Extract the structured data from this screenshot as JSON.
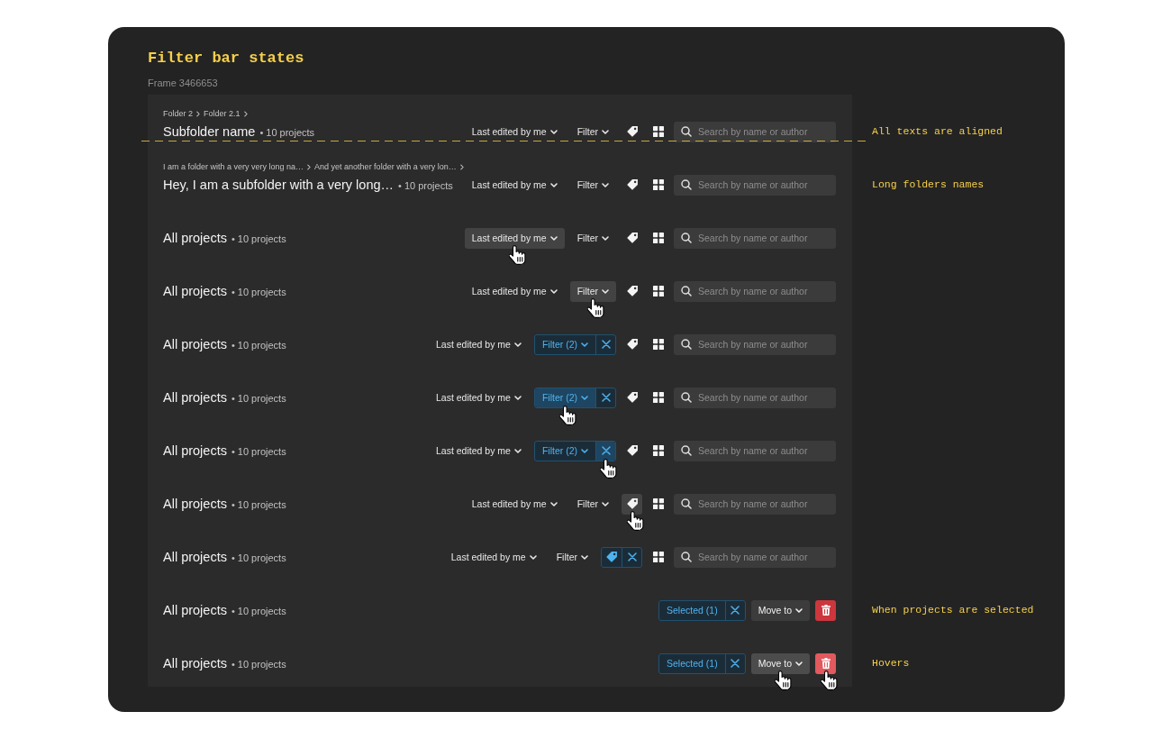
{
  "header": {
    "title": "Filter bar states",
    "frame_label": "Frame 3466653"
  },
  "rows": [
    {
      "breadcrumbs": [
        "Folder 2",
        "Folder 2.1"
      ],
      "title": "Subfolder name",
      "count": "• 10 projects",
      "note": {
        "text": "All texts are aligned",
        "guide": true
      },
      "controls": [
        {
          "kind": "dropdown",
          "label": "Last edited by me",
          "hovered": false
        },
        {
          "kind": "dropdown",
          "label": "Filter",
          "hovered": false
        },
        {
          "kind": "tag_button",
          "hovered": false
        },
        {
          "kind": "view_button"
        },
        {
          "kind": "search",
          "placeholder": "Search by name or author"
        }
      ]
    },
    {
      "breadcrumbs": [
        "I am a folder with a very very long na…",
        "And yet another folder with a very lon…"
      ],
      "title": "Hey, I am a subfolder with a very long…",
      "count": "• 10 projects",
      "note": {
        "text": "Long folders names",
        "guide": false
      },
      "controls": [
        {
          "kind": "dropdown",
          "label": "Last edited by me",
          "hovered": false
        },
        {
          "kind": "dropdown",
          "label": "Filter",
          "hovered": false
        },
        {
          "kind": "tag_button",
          "hovered": false
        },
        {
          "kind": "view_button"
        },
        {
          "kind": "search",
          "placeholder": "Search by name or author"
        }
      ]
    },
    {
      "title": "All projects",
      "count": "• 10 projects",
      "controls": [
        {
          "kind": "dropdown",
          "label": "Last edited by me",
          "hovered": true
        },
        {
          "kind": "dropdown",
          "label": "Filter",
          "hovered": false
        },
        {
          "kind": "tag_button",
          "hovered": false
        },
        {
          "kind": "view_button"
        },
        {
          "kind": "search",
          "placeholder": "Search by name or author"
        }
      ]
    },
    {
      "title": "All projects",
      "count": "• 10 projects",
      "controls": [
        {
          "kind": "dropdown",
          "label": "Last edited by me",
          "hovered": false
        },
        {
          "kind": "dropdown",
          "label": "Filter",
          "hovered": true
        },
        {
          "kind": "tag_button",
          "hovered": false
        },
        {
          "kind": "view_button"
        },
        {
          "kind": "search",
          "placeholder": "Search by name or author"
        }
      ]
    },
    {
      "title": "All projects",
      "count": "• 10 projects",
      "controls": [
        {
          "kind": "dropdown",
          "label": "Last edited by me",
          "hovered": false
        },
        {
          "kind": "chip",
          "label": "Filter (2)",
          "dropdown": true,
          "hovered": false,
          "clear_hovered": false
        },
        {
          "kind": "tag_button",
          "hovered": false
        },
        {
          "kind": "view_button"
        },
        {
          "kind": "search",
          "placeholder": "Search by name or author"
        }
      ]
    },
    {
      "title": "All projects",
      "count": "• 10 projects",
      "controls": [
        {
          "kind": "dropdown",
          "label": "Last edited by me",
          "hovered": false
        },
        {
          "kind": "chip",
          "label": "Filter (2)",
          "dropdown": true,
          "hovered": true,
          "clear_hovered": false
        },
        {
          "kind": "tag_button",
          "hovered": false
        },
        {
          "kind": "view_button"
        },
        {
          "kind": "search",
          "placeholder": "Search by name or author"
        }
      ]
    },
    {
      "title": "All projects",
      "count": "• 10 projects",
      "controls": [
        {
          "kind": "dropdown",
          "label": "Last edited by me",
          "hovered": false
        },
        {
          "kind": "chip",
          "label": "Filter (2)",
          "dropdown": true,
          "hovered": false,
          "clear_hovered": true
        },
        {
          "kind": "tag_button",
          "hovered": false
        },
        {
          "kind": "view_button"
        },
        {
          "kind": "search",
          "placeholder": "Search by name or author"
        }
      ]
    },
    {
      "title": "All projects",
      "count": "• 10 projects",
      "controls": [
        {
          "kind": "dropdown",
          "label": "Last edited by me",
          "hovered": false
        },
        {
          "kind": "dropdown",
          "label": "Filter",
          "hovered": false
        },
        {
          "kind": "tag_button",
          "hovered": true
        },
        {
          "kind": "view_button"
        },
        {
          "kind": "search",
          "placeholder": "Search by name or author"
        }
      ]
    },
    {
      "title": "All projects",
      "count": "• 10 projects",
      "controls": [
        {
          "kind": "dropdown",
          "label": "Last edited by me",
          "hovered": false
        },
        {
          "kind": "dropdown",
          "label": "Filter",
          "hovered": false
        },
        {
          "kind": "tag_chip",
          "hovered": false,
          "clear_hovered": false
        },
        {
          "kind": "view_button"
        },
        {
          "kind": "search",
          "placeholder": "Search by name or author"
        }
      ]
    },
    {
      "title": "All projects",
      "count": "• 10 projects",
      "note": {
        "text": "When projects are selected",
        "guide": false
      },
      "controls": [
        {
          "kind": "chip",
          "label": "Selected (1)",
          "dropdown": false,
          "hovered": false,
          "clear_hovered": false
        },
        {
          "kind": "menu_button",
          "label": "Move to",
          "hovered": false
        },
        {
          "kind": "delete_button",
          "hovered": false
        }
      ]
    },
    {
      "title": "All projects",
      "count": "• 10 projects",
      "note": {
        "text": "Hovers",
        "guide": false
      },
      "controls": [
        {
          "kind": "chip",
          "label": "Selected (1)",
          "dropdown": false,
          "hovered": false,
          "clear_hovered": false
        },
        {
          "kind": "menu_button",
          "label": "Move to",
          "hovered": true
        },
        {
          "kind": "delete_button",
          "hovered": true
        }
      ]
    }
  ]
}
